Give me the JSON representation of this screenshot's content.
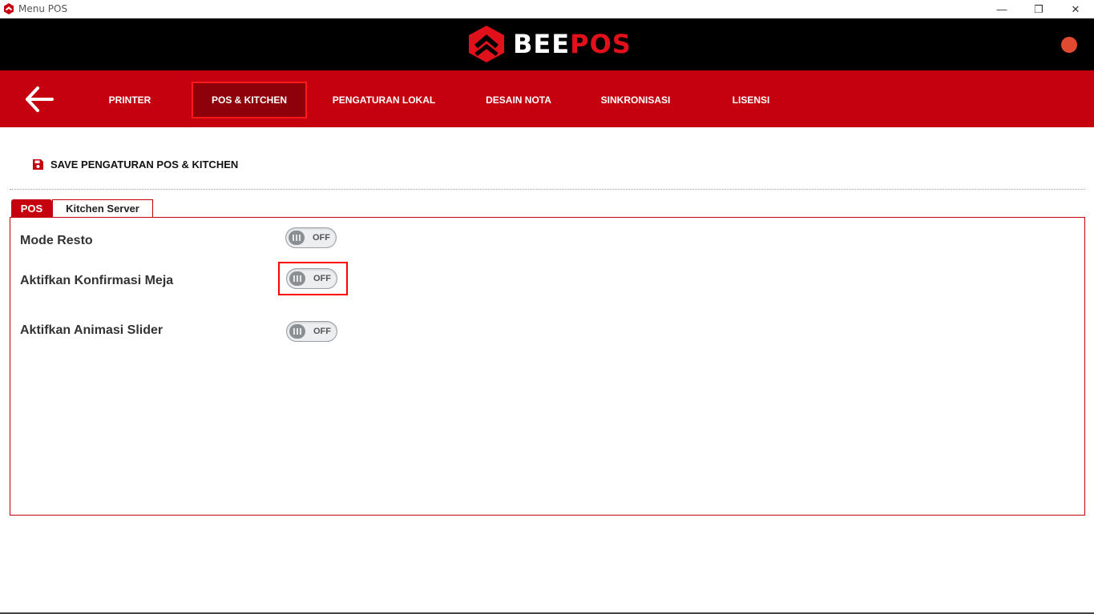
{
  "window": {
    "title": "Menu POS",
    "minimize_glyph": "—",
    "maximize_glyph": "❐",
    "close_glyph": "✕"
  },
  "brand": {
    "word_white": "BEE",
    "word_red": "POS",
    "accent_color": "#e0111a",
    "nav_color": "#c5000f"
  },
  "nav": {
    "back_icon": "arrow-left-icon",
    "tabs": [
      {
        "label": "PRINTER",
        "active": false
      },
      {
        "label": "POS & KITCHEN",
        "active": true
      },
      {
        "label": "PENGATURAN LOKAL",
        "active": false
      },
      {
        "label": "DESAIN NOTA",
        "active": false
      },
      {
        "label": "SINKRONISASI",
        "active": false
      },
      {
        "label": "LISENSI",
        "active": false
      }
    ]
  },
  "save": {
    "icon": "floppy-disk-icon",
    "label": "SAVE PENGATURAN POS & KITCHEN"
  },
  "tabs": [
    {
      "label": "POS",
      "active": true
    },
    {
      "label": "Kitchen Server",
      "active": false
    }
  ],
  "settings": [
    {
      "label": "Mode Resto",
      "state": "OFF"
    },
    {
      "label": "Aktifkan Konfirmasi Meja",
      "state": "OFF"
    },
    {
      "label": "Aktifkan Animasi Slider",
      "state": "OFF"
    }
  ]
}
